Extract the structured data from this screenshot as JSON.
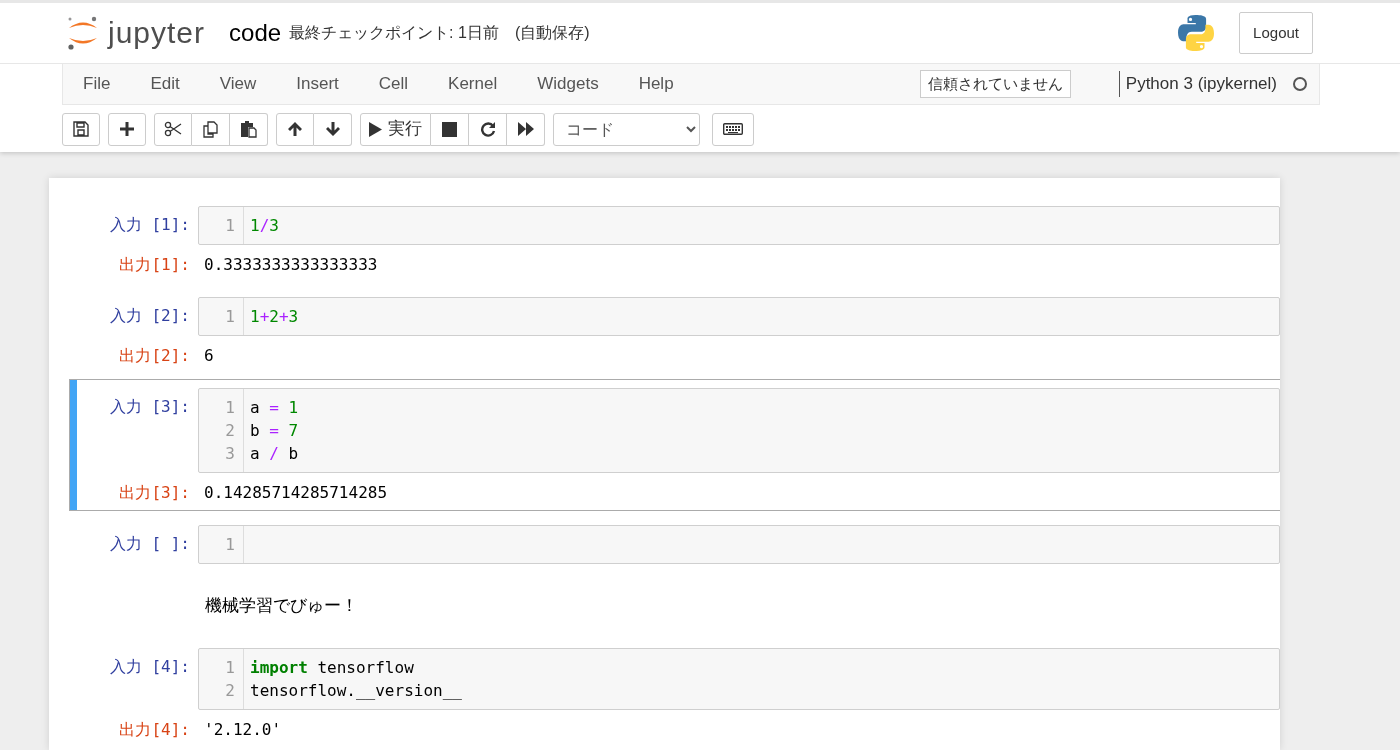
{
  "header": {
    "logo_text": "jupyter",
    "notebook_name": "code",
    "checkpoint": "最終チェックポイント: 1日前",
    "autosave": "(自動保存)",
    "logout": "Logout"
  },
  "menubar": {
    "items": [
      {
        "label": "File"
      },
      {
        "label": "Edit"
      },
      {
        "label": "View"
      },
      {
        "label": "Insert"
      },
      {
        "label": "Cell"
      },
      {
        "label": "Kernel"
      },
      {
        "label": "Widgets"
      },
      {
        "label": "Help"
      }
    ],
    "trust": "信頼されていません",
    "kernel": "Python 3 (ipykernel)",
    "kernel_busy": false
  },
  "toolbar": {
    "groups": [
      [
        {
          "kind": "save"
        }
      ],
      [
        {
          "kind": "add"
        }
      ],
      [
        {
          "kind": "cut"
        },
        {
          "kind": "copy"
        },
        {
          "kind": "paste"
        }
      ],
      [
        {
          "kind": "up"
        },
        {
          "kind": "down"
        }
      ],
      [
        {
          "kind": "run",
          "label": "実行"
        },
        {
          "kind": "stop"
        },
        {
          "kind": "restart"
        },
        {
          "kind": "forward"
        }
      ]
    ],
    "cell_type": "コード"
  },
  "cells": [
    {
      "kind": "code",
      "selected": false,
      "prompt": "入力 [1]:",
      "lines": [
        {
          "number": "1",
          "tokens": [
            {
              "kind": "number",
              "text": "1"
            },
            {
              "kind": "operator",
              "text": "/"
            },
            {
              "kind": "number",
              "text": "3"
            }
          ]
        }
      ],
      "output": {
        "prompt": "出力[1]:",
        "text": "0.3333333333333333"
      }
    },
    {
      "kind": "code",
      "selected": false,
      "prompt": "入力 [2]:",
      "lines": [
        {
          "number": "1",
          "tokens": [
            {
              "kind": "number",
              "text": "1"
            },
            {
              "kind": "operator",
              "text": "+"
            },
            {
              "kind": "number",
              "text": "2"
            },
            {
              "kind": "operator",
              "text": "+"
            },
            {
              "kind": "number",
              "text": "3"
            }
          ]
        }
      ],
      "output": {
        "prompt": "出力[2]:",
        "text": "6"
      }
    },
    {
      "kind": "code",
      "selected": true,
      "prompt": "入力 [3]:",
      "lines": [
        {
          "number": "1",
          "tokens": [
            {
              "kind": "name",
              "text": "a "
            },
            {
              "kind": "operator",
              "text": "= "
            },
            {
              "kind": "number",
              "text": "1"
            }
          ]
        },
        {
          "number": "2",
          "tokens": [
            {
              "kind": "name",
              "text": "b "
            },
            {
              "kind": "operator",
              "text": "= "
            },
            {
              "kind": "number",
              "text": "7"
            }
          ]
        },
        {
          "number": "3",
          "tokens": [
            {
              "kind": "name",
              "text": "a "
            },
            {
              "kind": "operator",
              "text": "/ "
            },
            {
              "kind": "name",
              "text": "b"
            }
          ]
        }
      ],
      "output": {
        "prompt": "出力[3]:",
        "text": "0.14285714285714285"
      }
    },
    {
      "kind": "code",
      "selected": false,
      "prompt": "入力 [ ]:",
      "lines": [
        {
          "number": "1"
        }
      ]
    },
    {
      "kind": "markdown",
      "selected": false,
      "text": "機械学習でびゅー！"
    },
    {
      "kind": "code",
      "selected": false,
      "prompt": "入力 [4]:",
      "lines": [
        {
          "number": "1",
          "tokens": [
            {
              "kind": "keyword",
              "text": "import"
            },
            {
              "kind": "name",
              "text": " tensorflow"
            }
          ]
        },
        {
          "number": "2",
          "tokens": [
            {
              "kind": "name",
              "text": "tensorflow.__version__"
            }
          ]
        }
      ],
      "output": {
        "prompt": "出力[4]:",
        "text": "'2.12.0'"
      }
    }
  ]
}
